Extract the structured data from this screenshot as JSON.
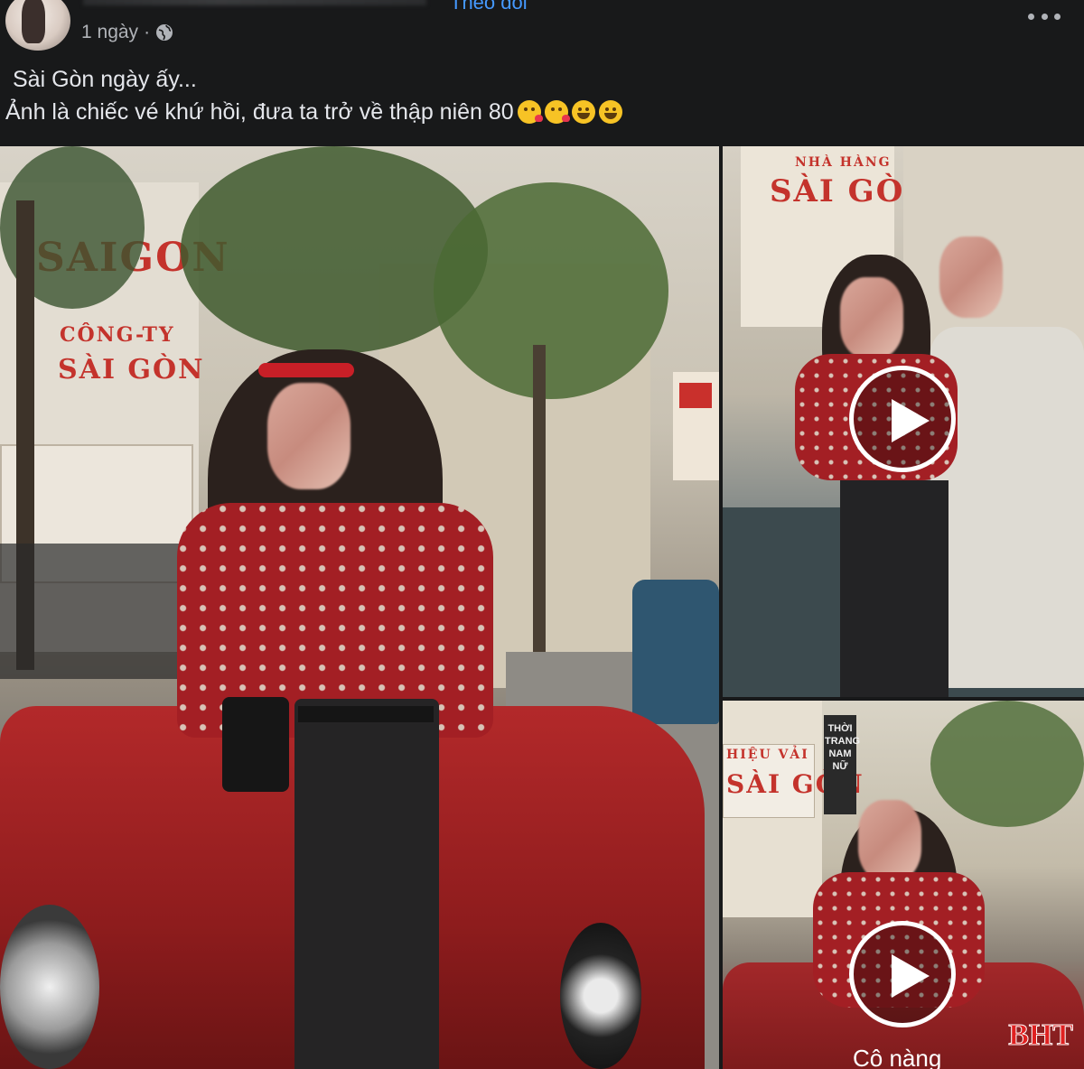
{
  "post": {
    "follow_text": "Theo dõi",
    "time": "1 ngày",
    "privacy_icon": "globe-icon",
    "more_icon": "more-options-icon",
    "caption_line1": "Sài Gòn ngày ấy...",
    "caption_line2": "Ảnh là chiếc vé khứ hồi, đưa ta trở về thập niên 80",
    "emojis": [
      "kissing-face-icon",
      "kissing-face-icon",
      "rolling-laughing-icon",
      "rolling-laughing-icon"
    ]
  },
  "photos": {
    "main": {
      "sign_saigon": "SAIGON",
      "sign_cong_ty_1": "CÔNG-TY",
      "sign_cong_ty_2": "SÀI GÒN"
    },
    "top_right": {
      "sign_nha_hang": "NHÀ HÀNG",
      "sign_sai_gon": "SÀI GÒN"
    },
    "bottom_right": {
      "sign_hieu_vai": "HIỆU VẢI",
      "sign_sai_gon": "SÀI GÒN",
      "sign_thoi_trang": "THỜI TRANG NAM NỮ",
      "video_caption": "Cô nàng",
      "watermark": "BHT"
    }
  }
}
